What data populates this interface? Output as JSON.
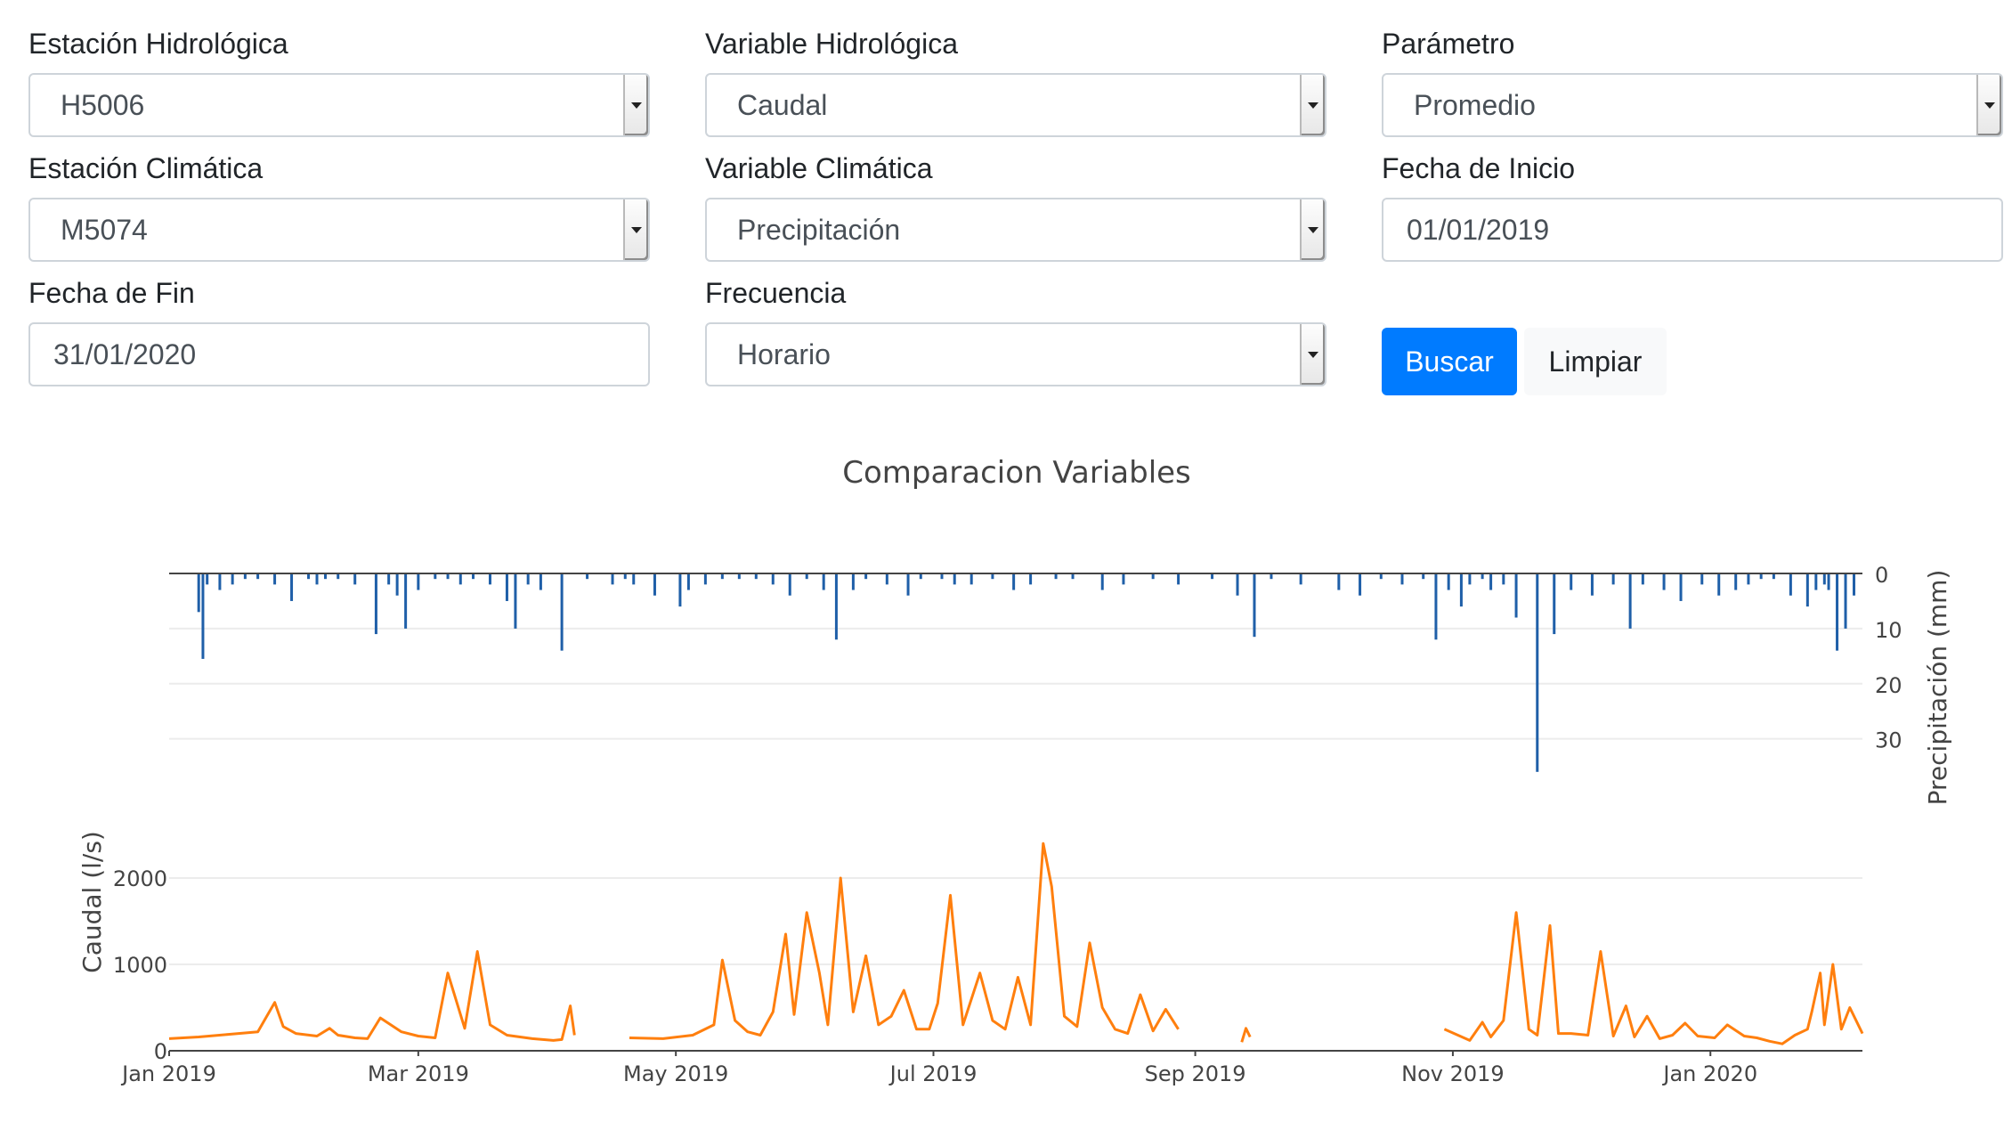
{
  "form": {
    "estacion_hidrologica": {
      "label": "Estación Hidrológica",
      "value": "H5006"
    },
    "variable_hidrologica": {
      "label": "Variable Hidrológica",
      "value": "Caudal"
    },
    "parametro": {
      "label": "Parámetro",
      "value": "Promedio"
    },
    "estacion_climatica": {
      "label": "Estación Climática",
      "value": "M5074"
    },
    "variable_climatica": {
      "label": "Variable Climática",
      "value": "Precipitación"
    },
    "fecha_inicio": {
      "label": "Fecha de Inicio",
      "value": "01/01/2019"
    },
    "fecha_fin": {
      "label": "Fecha de Fin",
      "value": "31/01/2020"
    },
    "frecuencia": {
      "label": "Frecuencia",
      "value": "Horario"
    },
    "buscar_label": "Buscar",
    "limpiar_label": "Limpiar"
  },
  "chart_data": {
    "type": "line",
    "title": "Comparacion Variables",
    "colors": {
      "caudal": "#ff7f0e",
      "precipitacion": "#1f5fa8"
    },
    "x_tick_labels": [
      "Jan 2019",
      "Mar 2019",
      "May 2019",
      "Jul 2019",
      "Sep 2019",
      "Nov 2019",
      "Jan 2020"
    ],
    "x_range": [
      "2019-01-01",
      "2020-02-06"
    ],
    "precipitation_panel": {
      "ylabel": "Precipitación (mm)",
      "y_axis": "reversed",
      "yticks": [
        0,
        10,
        20,
        30
      ],
      "ylim": [
        0,
        37
      ],
      "series_name": "Precipitación",
      "x": [
        "2019-01-08",
        "2019-01-09",
        "2019-01-10",
        "2019-01-13",
        "2019-01-16",
        "2019-01-19",
        "2019-01-22",
        "2019-01-26",
        "2019-01-30",
        "2019-02-03",
        "2019-02-05",
        "2019-02-07",
        "2019-02-10",
        "2019-02-14",
        "2019-02-19",
        "2019-02-22",
        "2019-02-24",
        "2019-02-26",
        "2019-03-01",
        "2019-03-05",
        "2019-03-08",
        "2019-03-11",
        "2019-03-14",
        "2019-03-18",
        "2019-03-22",
        "2019-03-24",
        "2019-03-27",
        "2019-03-30",
        "2019-04-04",
        "2019-04-10",
        "2019-04-16",
        "2019-04-19",
        "2019-04-21",
        "2019-04-26",
        "2019-05-02",
        "2019-05-04",
        "2019-05-08",
        "2019-05-12",
        "2019-05-16",
        "2019-05-20",
        "2019-05-24",
        "2019-05-28",
        "2019-06-01",
        "2019-06-05",
        "2019-06-08",
        "2019-06-12",
        "2019-06-15",
        "2019-06-20",
        "2019-06-25",
        "2019-06-28",
        "2019-07-03",
        "2019-07-06",
        "2019-07-10",
        "2019-07-15",
        "2019-07-20",
        "2019-07-24",
        "2019-07-30",
        "2019-08-03",
        "2019-08-10",
        "2019-08-15",
        "2019-08-22",
        "2019-08-28",
        "2019-09-05",
        "2019-09-11",
        "2019-09-15",
        "2019-09-19",
        "2019-09-26",
        "2019-10-05",
        "2019-10-10",
        "2019-10-15",
        "2019-10-20",
        "2019-10-25",
        "2019-10-28",
        "2019-10-31",
        "2019-11-03",
        "2019-11-05",
        "2019-11-08",
        "2019-11-10",
        "2019-11-13",
        "2019-11-16",
        "2019-11-21",
        "2019-11-25",
        "2019-11-29",
        "2019-12-04",
        "2019-12-09",
        "2019-12-13",
        "2019-12-16",
        "2019-12-21",
        "2019-12-25",
        "2019-12-30",
        "2020-01-03",
        "2020-01-07",
        "2020-01-10",
        "2020-01-13",
        "2020-01-16",
        "2020-01-20",
        "2020-01-24",
        "2020-01-26",
        "2020-01-28",
        "2020-01-29",
        "2020-01-31",
        "2020-02-02",
        "2020-02-04"
      ],
      "values": [
        7,
        15.5,
        2,
        3,
        2,
        1,
        1,
        2,
        5,
        1,
        2,
        1,
        1,
        2,
        11,
        2,
        4,
        10,
        3,
        1,
        1,
        2,
        1,
        2,
        5,
        10,
        2,
        3,
        14,
        1,
        2,
        1,
        2,
        4,
        6,
        3,
        2,
        1,
        1,
        1,
        2,
        4,
        1,
        3,
        12,
        3,
        1,
        2,
        4,
        1,
        1,
        2,
        2,
        1,
        3,
        2,
        1,
        1,
        3,
        2,
        1,
        2,
        1,
        4,
        11.5,
        1,
        2,
        3,
        4,
        1,
        2,
        1,
        12,
        3,
        6,
        2,
        1,
        3,
        2,
        8,
        36,
        11,
        3,
        4,
        2,
        10,
        2,
        3,
        5,
        2,
        4,
        3,
        2,
        1,
        1,
        4,
        6,
        3,
        2,
        3,
        14,
        10,
        4
      ]
    },
    "caudal_panel": {
      "ylabel": "Caudal (l/s)",
      "yticks": [
        0,
        1000,
        2000
      ],
      "ylim": [
        0,
        2500
      ],
      "series_name": "Caudal",
      "segments": [
        {
          "x": [
            "2019-01-01",
            "2019-01-08",
            "2019-01-15",
            "2019-01-22",
            "2019-01-26",
            "2019-01-28",
            "2019-01-31",
            "2019-02-05",
            "2019-02-08",
            "2019-02-10",
            "2019-02-14",
            "2019-02-17",
            "2019-02-20",
            "2019-02-25",
            "2019-03-01",
            "2019-03-05",
            "2019-03-08",
            "2019-03-12",
            "2019-03-15",
            "2019-03-18",
            "2019-03-22",
            "2019-03-28",
            "2019-04-02",
            "2019-04-04",
            "2019-04-06",
            "2019-04-07"
          ],
          "values": [
            140,
            160,
            190,
            220,
            560,
            280,
            200,
            170,
            260,
            180,
            150,
            140,
            380,
            220,
            170,
            150,
            900,
            260,
            1150,
            300,
            180,
            140,
            120,
            130,
            520,
            180
          ]
        },
        {
          "x": [
            "2019-04-20",
            "2019-04-28",
            "2019-05-05",
            "2019-05-10",
            "2019-05-12",
            "2019-05-15",
            "2019-05-18",
            "2019-05-21",
            "2019-05-24",
            "2019-05-27",
            "2019-05-29",
            "2019-06-01",
            "2019-06-04",
            "2019-06-06",
            "2019-06-09",
            "2019-06-12",
            "2019-06-15",
            "2019-06-18",
            "2019-06-21",
            "2019-06-24",
            "2019-06-27",
            "2019-06-30",
            "2019-07-02",
            "2019-07-05",
            "2019-07-08",
            "2019-07-12",
            "2019-07-15",
            "2019-07-18",
            "2019-07-21",
            "2019-07-24",
            "2019-07-27",
            "2019-07-29",
            "2019-08-01",
            "2019-08-04",
            "2019-08-07",
            "2019-08-10",
            "2019-08-13",
            "2019-08-16",
            "2019-08-19",
            "2019-08-22",
            "2019-08-25",
            "2019-08-28"
          ],
          "values": [
            150,
            140,
            180,
            300,
            1050,
            350,
            220,
            180,
            450,
            1350,
            420,
            1600,
            900,
            300,
            2000,
            450,
            1100,
            300,
            400,
            700,
            250,
            250,
            550,
            1800,
            300,
            900,
            350,
            250,
            850,
            300,
            2400,
            1900,
            400,
            280,
            1250,
            500,
            250,
            200,
            650,
            230,
            480,
            250
          ]
        },
        {
          "x": [
            "2019-09-12",
            "2019-09-13",
            "2019-09-14"
          ],
          "values": [
            100,
            260,
            160
          ]
        },
        {
          "x": [
            "2019-10-30",
            "2019-11-05",
            "2019-11-08",
            "2019-11-10",
            "2019-11-13",
            "2019-11-16",
            "2019-11-19",
            "2019-11-21",
            "2019-11-24",
            "2019-11-26",
            "2019-11-29",
            "2019-12-03",
            "2019-12-06",
            "2019-12-09",
            "2019-12-12",
            "2019-12-14",
            "2019-12-17",
            "2019-12-20",
            "2019-12-23",
            "2019-12-26",
            "2019-12-29",
            "2020-01-02",
            "2020-01-05",
            "2020-01-09",
            "2020-01-12",
            "2020-01-15",
            "2020-01-18",
            "2020-01-21",
            "2020-01-24",
            "2020-01-25",
            "2020-01-27",
            "2020-01-28",
            "2020-01-30",
            "2020-02-01",
            "2020-02-03",
            "2020-02-06"
          ],
          "values": [
            250,
            120,
            330,
            160,
            350,
            1600,
            250,
            180,
            1450,
            200,
            200,
            180,
            1150,
            170,
            520,
            160,
            400,
            140,
            180,
            320,
            170,
            150,
            300,
            170,
            150,
            110,
            80,
            180,
            250,
            450,
            900,
            300,
            1000,
            250,
            500,
            200
          ]
        }
      ]
    }
  }
}
